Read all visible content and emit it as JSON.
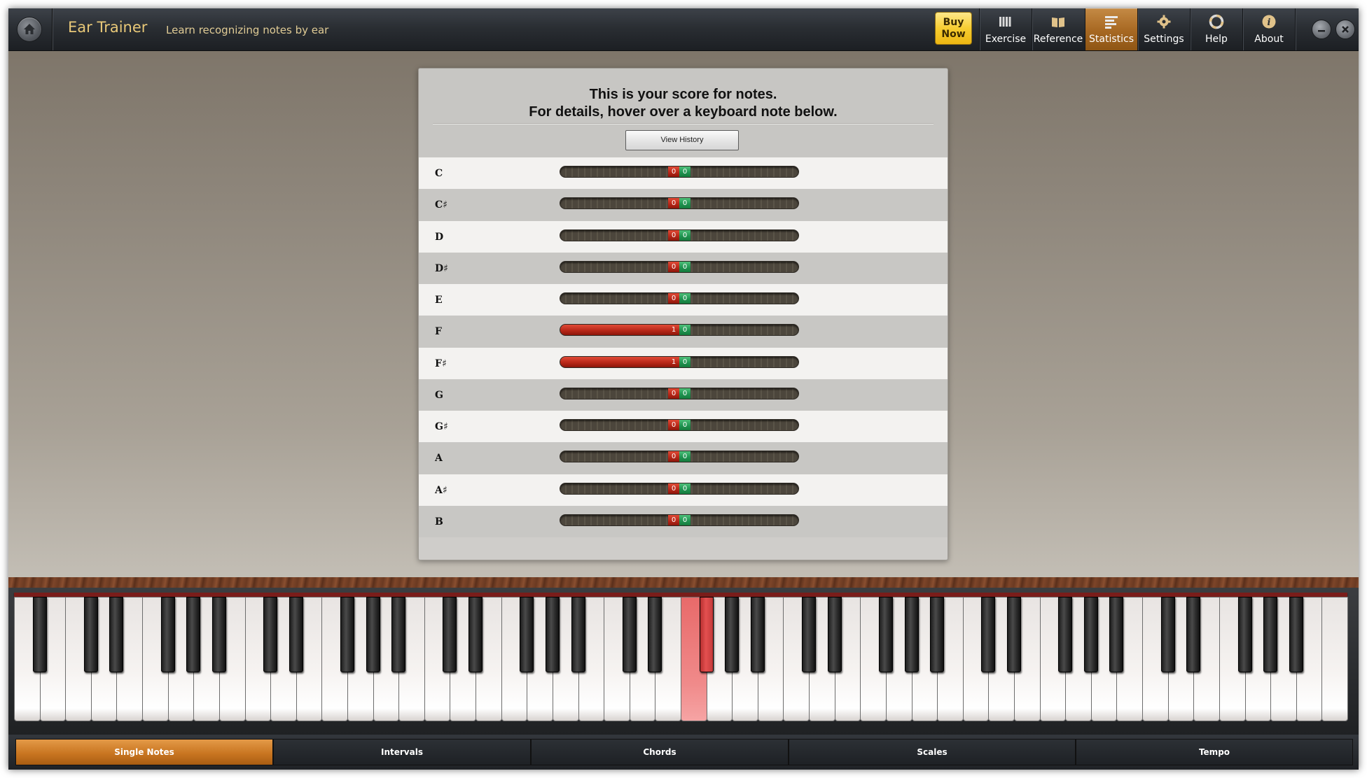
{
  "app": {
    "title": "Ear Trainer",
    "subtitle": "Learn recognizing notes by ear",
    "buy_now": [
      "Buy",
      "Now"
    ],
    "accent_color": "#c4833a"
  },
  "nav": {
    "items": [
      {
        "label": "Exercise",
        "icon": "piano-keys-icon"
      },
      {
        "label": "Reference",
        "icon": "book-icon"
      },
      {
        "label": "Statistics",
        "icon": "bars-icon",
        "active": true
      },
      {
        "label": "Settings",
        "icon": "gear-icon"
      },
      {
        "label": "Help",
        "icon": "lifebuoy-icon"
      },
      {
        "label": "About",
        "icon": "info-icon"
      }
    ]
  },
  "window_controls": [
    "minimize-icon",
    "close-icon"
  ],
  "panel": {
    "title_line1": "This is your score for notes.",
    "title_line2": "For details, hover over a keyboard note below.",
    "view_history": "View History"
  },
  "scores": [
    {
      "note": "C",
      "wrong": 0,
      "right": 0
    },
    {
      "note": "C♯",
      "wrong": 0,
      "right": 0
    },
    {
      "note": "D",
      "wrong": 0,
      "right": 0
    },
    {
      "note": "D♯",
      "wrong": 0,
      "right": 0
    },
    {
      "note": "E",
      "wrong": 0,
      "right": 0
    },
    {
      "note": "F",
      "wrong": 1,
      "right": 0
    },
    {
      "note": "F♯",
      "wrong": 1,
      "right": 0
    },
    {
      "note": "G",
      "wrong": 0,
      "right": 0
    },
    {
      "note": "G♯",
      "wrong": 0,
      "right": 0
    },
    {
      "note": "A",
      "wrong": 0,
      "right": 0
    },
    {
      "note": "A♯",
      "wrong": 0,
      "right": 0
    },
    {
      "note": "B",
      "wrong": 0,
      "right": 0
    }
  ],
  "keyboard": {
    "white_keys": 52,
    "first_note": "A",
    "highlighted_white": 26,
    "highlighted_black_after_white": 26
  },
  "modes": [
    {
      "label": "Single Notes",
      "active": true
    },
    {
      "label": "Intervals"
    },
    {
      "label": "Chords"
    },
    {
      "label": "Scales"
    },
    {
      "label": "Tempo"
    }
  ]
}
